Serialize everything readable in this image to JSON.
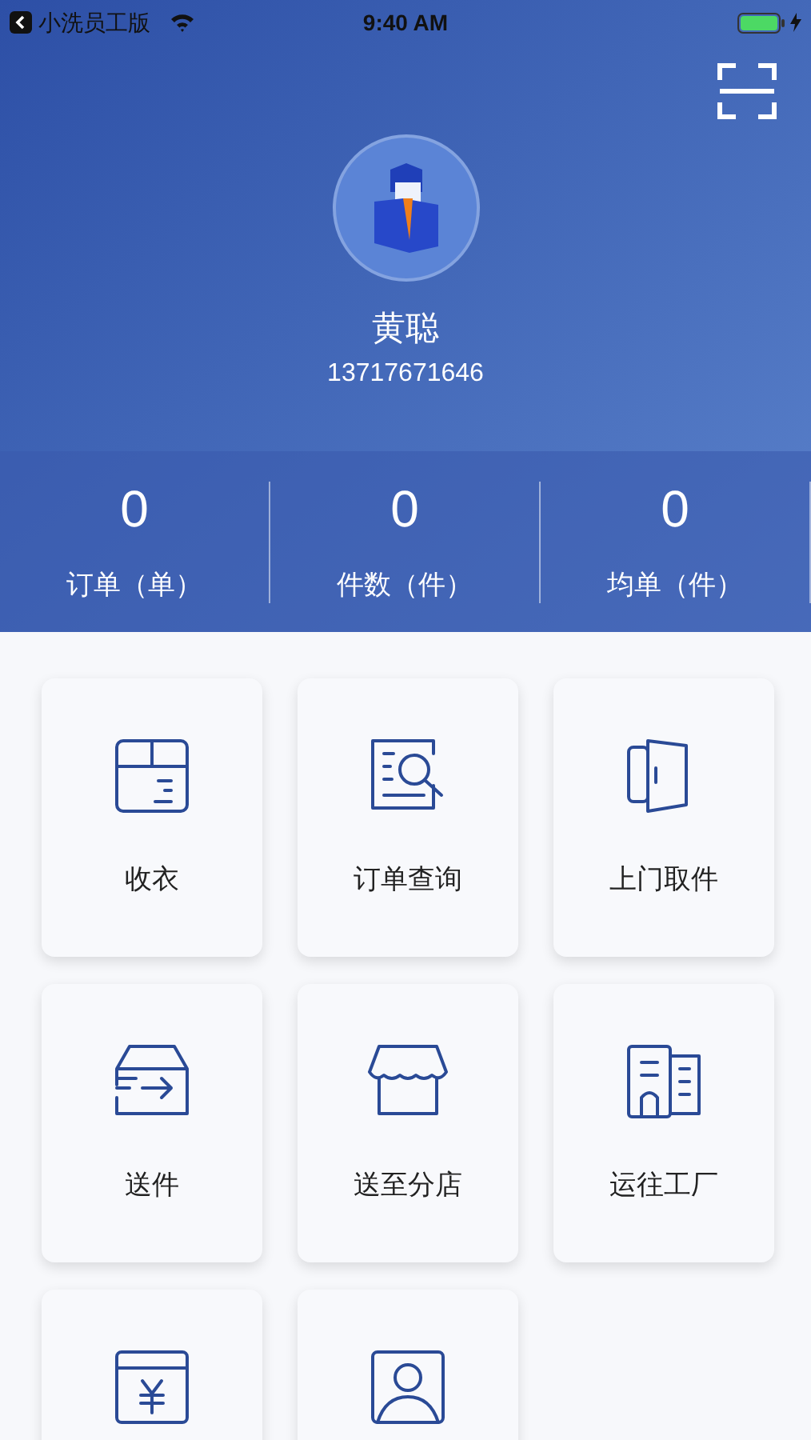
{
  "status_bar": {
    "back_app": "小洗员工版",
    "time": "9:40 AM"
  },
  "profile": {
    "name": "黄聪",
    "phone": "13717671646"
  },
  "stats": [
    {
      "value": "0",
      "label": "订单（单）"
    },
    {
      "value": "0",
      "label": "件数（件）"
    },
    {
      "value": "0",
      "label": "均单（件）"
    }
  ],
  "menu": [
    {
      "kind": "box",
      "label": "收衣"
    },
    {
      "kind": "search-doc",
      "label": "订单查询"
    },
    {
      "kind": "door",
      "label": "上门取件"
    },
    {
      "kind": "send-box",
      "label": "送件"
    },
    {
      "kind": "shop",
      "label": "送至分店"
    },
    {
      "kind": "building",
      "label": "运往工厂"
    },
    {
      "kind": "yen"
    },
    {
      "kind": "person"
    }
  ]
}
